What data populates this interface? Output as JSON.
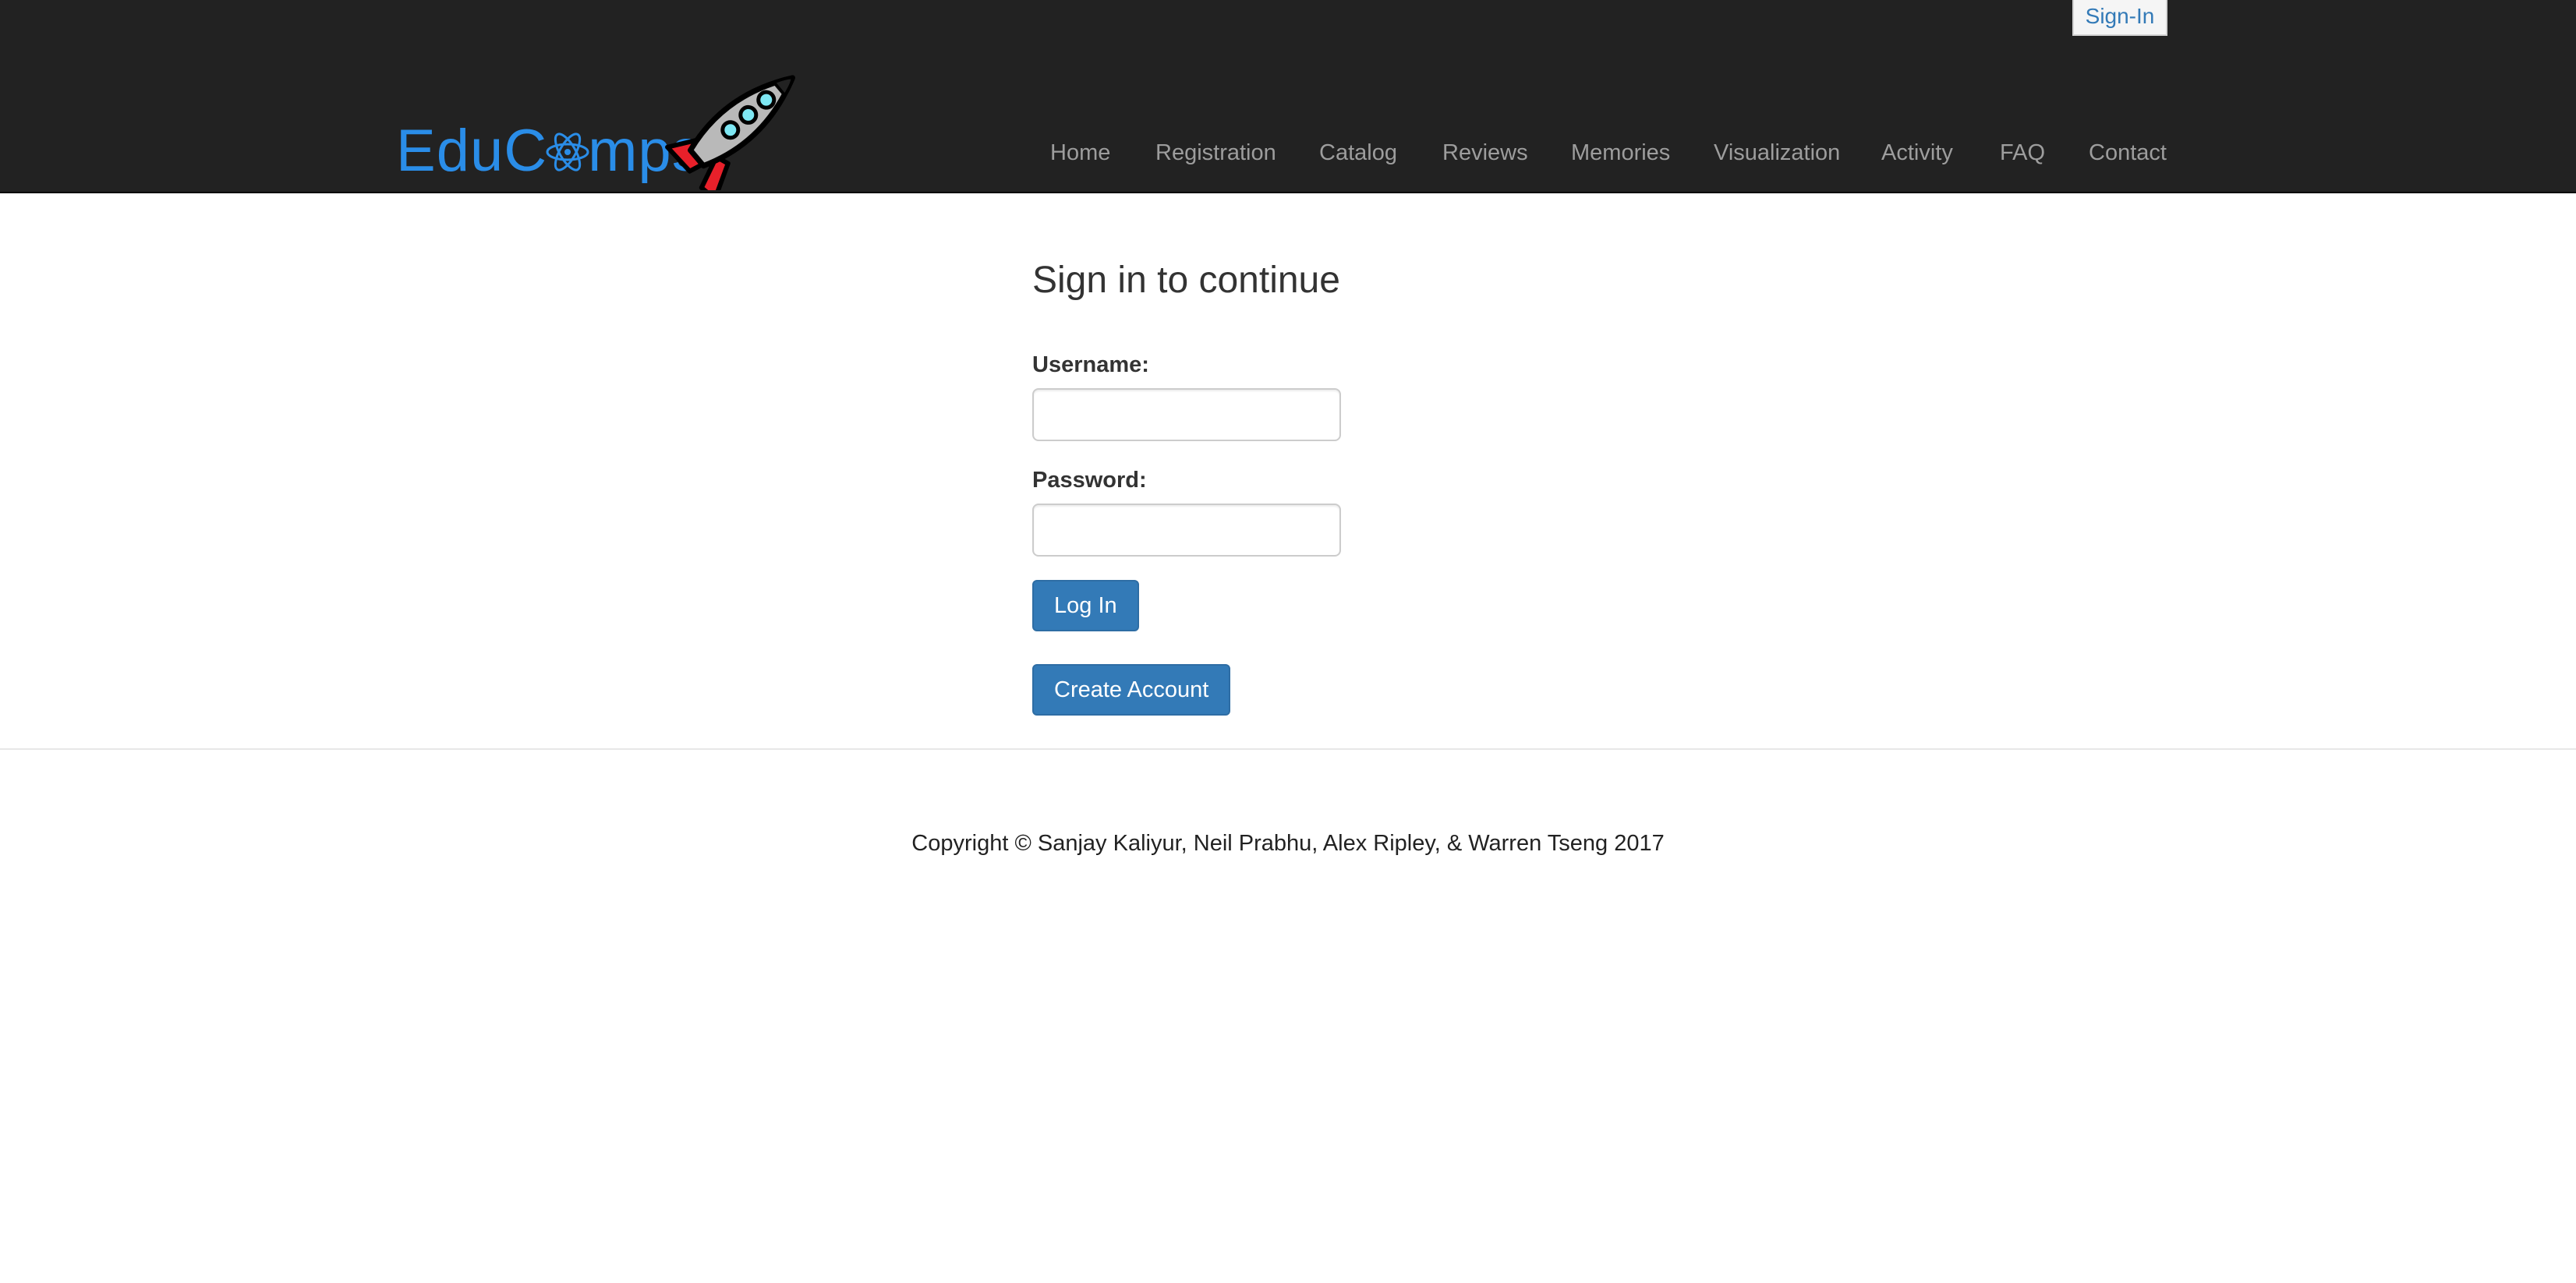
{
  "header": {
    "signin_label": "Sign-In",
    "logo_text_before": "EduC",
    "logo_text_after": "mps",
    "colors": {
      "navbar_bg": "#222222",
      "logo_blue": "#2a8de8",
      "nav_text": "#9d9d9d"
    },
    "nav": [
      {
        "label": "Home"
      },
      {
        "label": "Registration"
      },
      {
        "label": "Catalog"
      },
      {
        "label": "Reviews"
      },
      {
        "label": "Memories"
      },
      {
        "label": "Visualization"
      },
      {
        "label": "Activity"
      },
      {
        "label": "FAQ"
      },
      {
        "label": "Contact"
      }
    ]
  },
  "form": {
    "title": "Sign in to continue",
    "username_label": "Username:",
    "username_value": "",
    "password_label": "Password:",
    "password_value": "",
    "login_button": "Log In",
    "create_account_button": "Create Account",
    "button_color": "#337ab7"
  },
  "footer": {
    "copyright": "Copyright © Sanjay Kaliyur, Neil Prabhu, Alex Ripley, & Warren Tseng 2017"
  }
}
